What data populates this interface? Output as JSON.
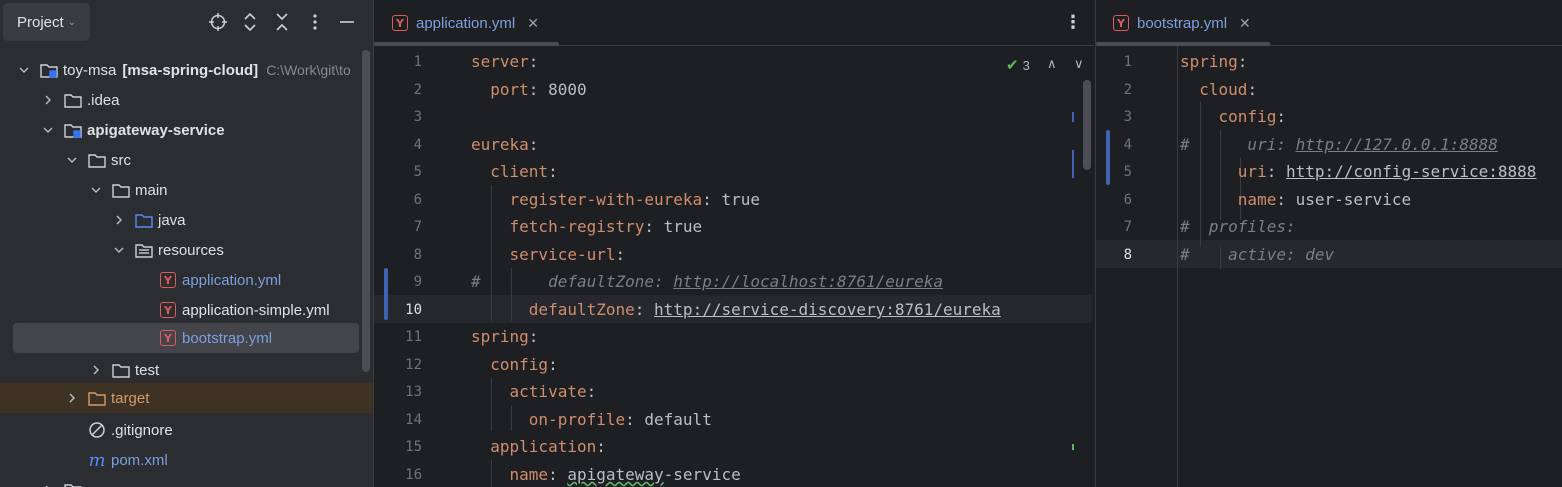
{
  "project_panel": {
    "title": "Project",
    "tree": [
      {
        "label": "toy-msa",
        "bold_suffix": "[msa-spring-cloud]",
        "path": "C:\\Work\\git\\to"
      },
      {
        "label": ".idea"
      },
      {
        "label": "apigateway-service"
      },
      {
        "label": "src"
      },
      {
        "label": "main"
      },
      {
        "label": "java"
      },
      {
        "label": "resources"
      },
      {
        "label": "application.yml"
      },
      {
        "label": "application-simple.yml"
      },
      {
        "label": "bootstrap.yml"
      },
      {
        "label": "test"
      },
      {
        "label": "target"
      },
      {
        "label": ".gitignore"
      },
      {
        "label": "pom.xml"
      }
    ],
    "colors": {
      "selected_bg": "#43454a",
      "target_bg": "#3d3223",
      "folder_target": "#d49a6a",
      "blue_file": "#7b9fe0"
    }
  },
  "editor_left": {
    "tab_label": "application.yml",
    "close_glyph": "✕",
    "inspection_count": "3",
    "line_numbers": [
      "1",
      "2",
      "3",
      "4",
      "5",
      "6",
      "7",
      "8",
      "9",
      "10",
      "11",
      "12",
      "13",
      "14",
      "15",
      "16"
    ],
    "current_line": "10"
  },
  "editor_right": {
    "tab_label": "bootstrap.yml",
    "close_glyph": "✕",
    "line_numbers": [
      "1",
      "2",
      "3",
      "4",
      "5",
      "6",
      "7",
      "8"
    ],
    "current_line": "8"
  }
}
